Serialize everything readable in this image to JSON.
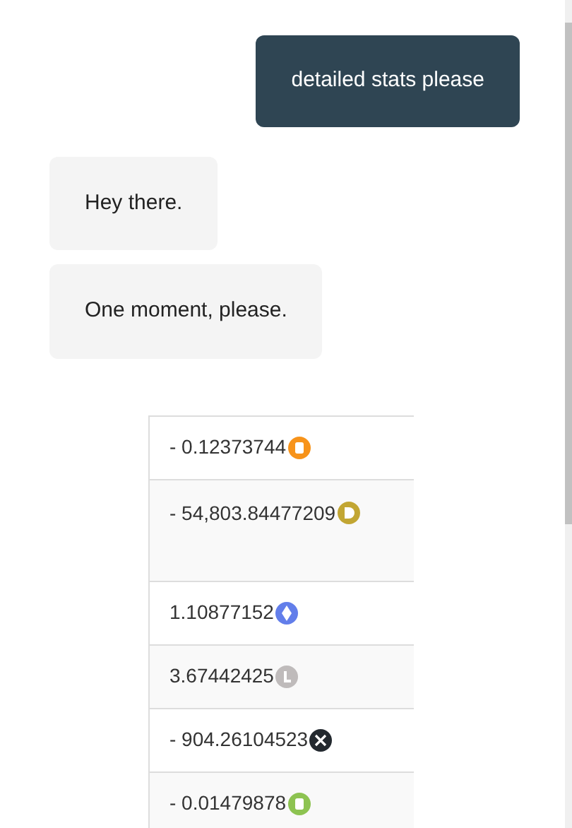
{
  "messages": [
    {
      "kind": "user",
      "text": "detailed stats please"
    },
    {
      "kind": "bot",
      "text": "Hey there."
    },
    {
      "kind": "bot",
      "text": "One moment, please."
    }
  ],
  "table": {
    "rows": [
      {
        "amount": "- 0.12373744",
        "kind": "bitcoin",
        "color": "#f7931a",
        "tall": false
      },
      {
        "amount": "- 54,803.84477209",
        "kind": "dogecoin",
        "color": "#c2a633",
        "tall": true
      },
      {
        "amount": "1.10877152",
        "kind": "ethereum",
        "color": "#627eea",
        "tall": false
      },
      {
        "amount": "3.67442425",
        "kind": "litecoin",
        "color": "#bfbbbb",
        "tall": false
      },
      {
        "amount": "- 904.26104523",
        "kind": "xrp",
        "color": "#23292f",
        "tall": false
      },
      {
        "amount": "- 0.01479878",
        "kind": "bitcoin",
        "color": "#8dc351",
        "tall": false
      }
    ]
  }
}
